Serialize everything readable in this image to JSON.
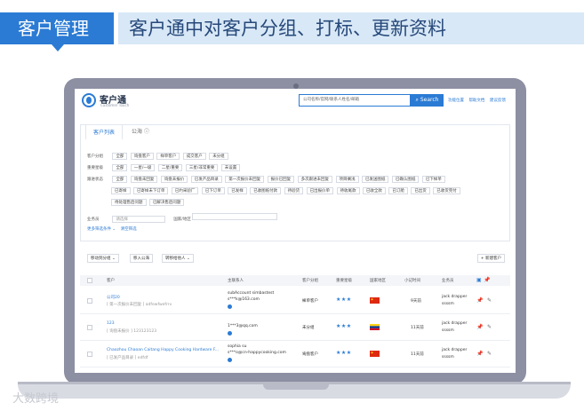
{
  "banner": {
    "tag": "客户管理",
    "title": "客户通中对客户分组、打标、更新资料"
  },
  "watermark": "大数跨境",
  "app": {
    "name": "客户通",
    "name_en": "Customer Touch",
    "search_placeholder": "公司名称/官网/联系人姓名/邮箱",
    "search_button": "Search",
    "top_links": [
      "功能位置",
      "帮助文档",
      "建议反馈"
    ]
  },
  "tabs": [
    "客户列表",
    "公海"
  ],
  "filters": {
    "rows": [
      {
        "label": "客户分组",
        "options": [
          "全部",
          "询盘客户",
          "样单客户",
          "成交客户",
          "未分组"
        ]
      },
      {
        "label": "重要星级",
        "options": [
          "全部",
          "一星/一级",
          "二星/重要",
          "三星/非常重要",
          "未设置"
        ]
      },
      {
        "label": "跟进状态",
        "options": [
          "全部",
          "询盘未回复",
          "询盘未报价",
          "已发产品目录",
          "第一次报价未回复",
          "报价已回复",
          "多次跟进未回复",
          "项目搁浅",
          "已发送图纸",
          "已确认图纸",
          "已下样单"
        ]
      },
      {
        "label": "",
        "options": [
          "已寄样",
          "已寄样未下订单",
          "已约采验厂",
          "已下订单",
          "已发样",
          "已收图纸付款",
          "待验货",
          "已出报价单",
          "待收尾款",
          "已收全款",
          "已订舱",
          "已出货",
          "已收货完付"
        ]
      },
      {
        "label": "",
        "options": [
          "待处理售后问题",
          "已解决售后问题"
        ]
      }
    ],
    "owner_label": "业务员",
    "owner_value": "请选择",
    "country_label": "国家/地区",
    "country_value": "",
    "more_label": "更多筛选条件",
    "clear_label": "清空筛选"
  },
  "actions": {
    "batch": "移动到分组",
    "to_sea": "移入公海",
    "transfer": "转移给他人",
    "new_customer": "+ 新建客户"
  },
  "table": {
    "headers": [
      "客户",
      "主联系人",
      "客户分组",
      "重要星级",
      "国家地区",
      "小记时间",
      "业务员"
    ],
    "rows": [
      {
        "company": "公司20",
        "company_sub": "[ 第一次报价未回复 ]  adfewfwefrrv",
        "contact_name": "subAccount simbastest",
        "contact_email": "s***k@163.com",
        "group": "样单客户",
        "stars": "★★★",
        "time": "9天前",
        "owner": "jack drapper",
        "owner_sub": "ssssm"
      },
      {
        "company": "123",
        "company_sub": "[ 询盘未报价 ]  123123123",
        "contact_name": "",
        "contact_email": "1***3@qq.com",
        "group": "未分组",
        "stars": "★★★",
        "time": "11天前",
        "owner": "jack drapper",
        "owner_sub": "ssssm"
      },
      {
        "company": "Chaozhou Chaoan Caitang Happy Cooking Hardware F...",
        "company_sub": "[ 已发产品目录 ]  edfdf",
        "contact_name": "sophia su",
        "contact_email": "s***o@cn-happycooking.com",
        "group": "询盘客户",
        "stars": "★★★",
        "time": "11天前",
        "owner": "jack drapper",
        "owner_sub": "ssssm"
      }
    ]
  },
  "colors": {
    "accent": "#2b7bd4",
    "banner_bg": "#d8e8f6",
    "laptop": "#8d8fa3"
  }
}
